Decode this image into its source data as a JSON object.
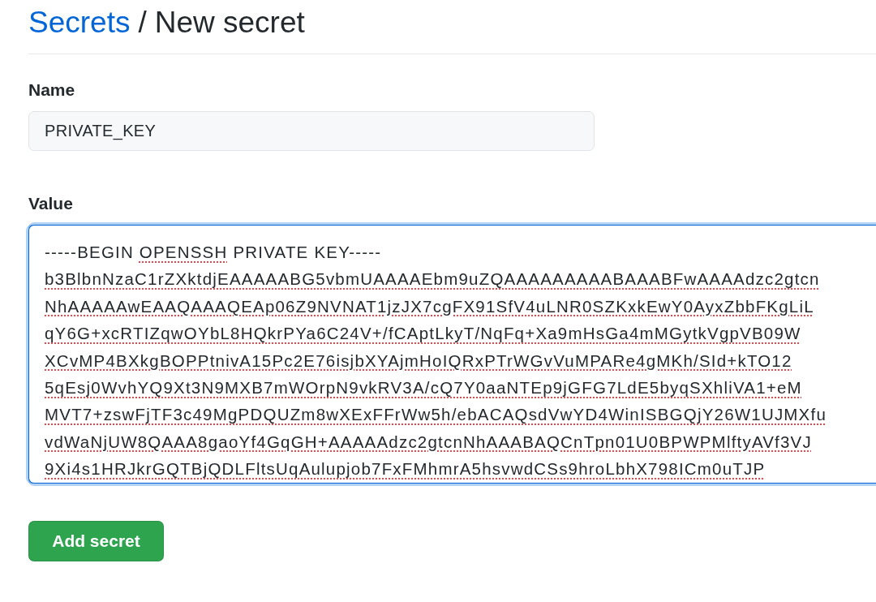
{
  "breadcrumb": {
    "link": "Secrets",
    "separator": "/",
    "current": "New secret"
  },
  "form": {
    "fields": [
      {
        "kind": "input",
        "label": "Name",
        "value": "PRIVATE_KEY",
        "focused": false
      },
      {
        "kind": "textarea",
        "label": "Value",
        "focused": true,
        "lines": [
          {
            "words": [
              {
                "text": "-----BEGIN",
                "misspelled": false
              },
              {
                "text": "OPENSSH",
                "misspelled": true
              },
              {
                "text": "PRIVATE",
                "misspelled": false
              },
              {
                "text": "KEY-----",
                "misspelled": false
              }
            ]
          },
          {
            "words": [
              {
                "text": "b3BlbnNzaC1rZXktdjEAAAAABG5vbmUAAAAEbm9uZQAAAAAAAAABAAABFwAAAAdzc2gtcn",
                "misspelled": true
              }
            ]
          },
          {
            "words": [
              {
                "text": "NhAAAAAwEAAQAAAQEAp06Z9NVNAT1jzJX7cgFX91SfV4uLNR0SZKxkEwY0AyxZbbFKgLiL",
                "misspelled": true
              }
            ]
          },
          {
            "words": [
              {
                "text": "qY6G+xcRTIZqwOYbL8HQkrPYa6C24V+/fCAptLkyT/NqFq+Xa9mHsGa4mMGytkVgpVB09W",
                "misspelled": true
              }
            ]
          },
          {
            "words": [
              {
                "text": "XCvMP4BXkgBOPPtnivA15Pc2E76isjbXYAjmHoIQRxPTrWGvVuMPARe4gMKh/SId+kTO12",
                "misspelled": true
              }
            ]
          },
          {
            "words": [
              {
                "text": "5qEsj0WvhYQ9Xt3N9MXB7mWOrpN9vkRV3A/cQ7Y0aaNTEp9jGFG7LdE5byqSXhliVA1+eM",
                "misspelled": true
              }
            ]
          },
          {
            "words": [
              {
                "text": "MVT7+zswFjTF3c49MgPDQUZm8wXExFFrWw5h/ebACAQsdVwYD4WinISBGQjY26W1UJMXfu",
                "misspelled": true
              }
            ]
          },
          {
            "words": [
              {
                "text": "vdWaNjUW8QAAA8gaoYf4GqGH+AAAAAdzc2gtcnNhAAABAQCnTpn01U0BPWPMlftyAVf3VJ",
                "misspelled": true
              }
            ]
          },
          {
            "words": [
              {
                "text": "9Xi4s1HRJkrGQTBjQDLFltsUqAulupjob7FxFMhmrA5hsvwdCSs9hroLbhX798ICm0uTJP",
                "misspelled": true
              }
            ]
          }
        ]
      }
    ],
    "submit_button": "Add secret"
  }
}
